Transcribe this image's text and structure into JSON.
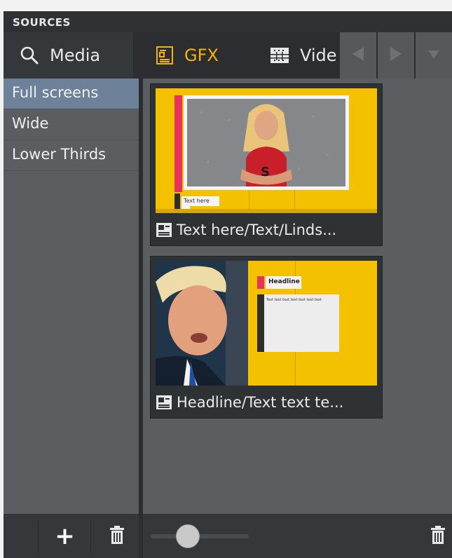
{
  "panel": {
    "title": "SOURCES"
  },
  "tabs": [
    {
      "label": "Media",
      "icon": "search-icon",
      "active": false
    },
    {
      "label": "GFX",
      "icon": "gfx-template-icon",
      "active": true
    },
    {
      "label": "Vide",
      "icon": "film-grid-icon",
      "active": false
    }
  ],
  "navigation": {
    "icons": [
      "arrow-left-icon",
      "arrow-right-icon",
      "chevron-down-icon"
    ]
  },
  "categories": [
    {
      "label": "Full screens",
      "selected": true
    },
    {
      "label": "Wide",
      "selected": false
    },
    {
      "label": "Lower Thirds",
      "selected": false
    }
  ],
  "items": [
    {
      "label": "Text here/Text/Linds...",
      "icon": "text-template-icon",
      "thumb_text": "Text here"
    },
    {
      "label": "Headline/Text text te...",
      "icon": "text-template-icon",
      "thumb_headline": "Headline",
      "thumb_body": "Text text text text text text text"
    }
  ],
  "footer": {
    "add_symbol": "+",
    "zoom_slider": {
      "value": 0.38
    }
  },
  "colors": {
    "accent": "#f5b400",
    "selected_category": "#6d8299",
    "panel_bg": "#5b5e61",
    "dark_bg": "#2b2d30",
    "graphic_yellow": "#f3c100",
    "graphic_pink": "#e8315d"
  }
}
